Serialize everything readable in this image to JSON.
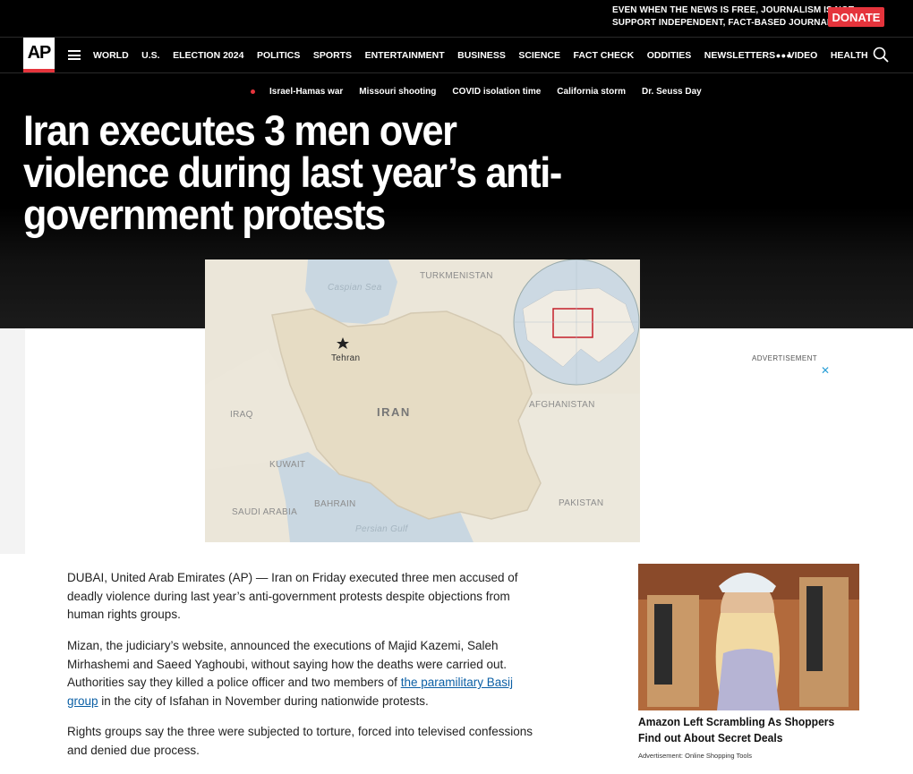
{
  "promo": {
    "line1": "EVEN WHEN THE NEWS IS FREE, JOURNALISM IS NOT.",
    "line2": "SUPPORT INDEPENDENT, FACT-BASED JOURNALISM.",
    "donate_label": "DONATE"
  },
  "logo": "AP",
  "nav": {
    "items": [
      "WORLD",
      "U.S.",
      "ELECTION 2024",
      "POLITICS",
      "SPORTS",
      "ENTERTAINMENT",
      "BUSINESS",
      "SCIENCE",
      "FACT CHECK",
      "ODDITIES",
      "NEWSLETTERS",
      "VIDEO",
      "HEALTH"
    ],
    "more": "•••"
  },
  "trending": [
    "Israel-Hamas war",
    "Missouri shooting",
    "COVID isolation time",
    "California storm",
    "Dr. Seuss Day"
  ],
  "article": {
    "headline": "Iran executes 3 men over violence during last year’s anti-government protests",
    "p1": "DUBAI, United Arab Emirates (AP) — Iran on Friday executed three men accused of deadly violence during last year’s anti-government protests despite objections from human rights groups.",
    "p2_before": "Mizan, the judiciary’s website, announced the executions of Majid Kazemi, Saleh Mirhashemi and Saeed Yaghoubi, without saying how the deaths were carried out. Authorities say they killed a police officer and two members of ",
    "p2_link": "the paramilitary Basij group",
    "p2_after": " in the city of Isfahan in November during nationwide protests.",
    "p3": "Rights groups say the three were subjected to torture, forced into televised confessions and denied due process."
  },
  "map": {
    "labels": {
      "caspian": "Caspian Sea",
      "turkmenistan": "TURKMENISTAN",
      "tehran": "Tehran",
      "iran": "IRAN",
      "iraq": "IRAQ",
      "afghanistan": "AFGHANISTAN",
      "kuwait": "KUWAIT",
      "bahrain": "BAHRAIN",
      "saudi": "SAUDI ARABIA",
      "pakistan": "PAKISTAN",
      "gulf": "Persian Gulf"
    }
  },
  "ad": {
    "label": "ADVERTISEMENT",
    "close": "✕",
    "title": "Amazon Left Scrambling As Shoppers Find out About Secret Deals",
    "source": "Advertisement:  Online Shopping Tools"
  },
  "colors": {
    "accent": "#e5343c",
    "link": "#0b5fa5"
  }
}
